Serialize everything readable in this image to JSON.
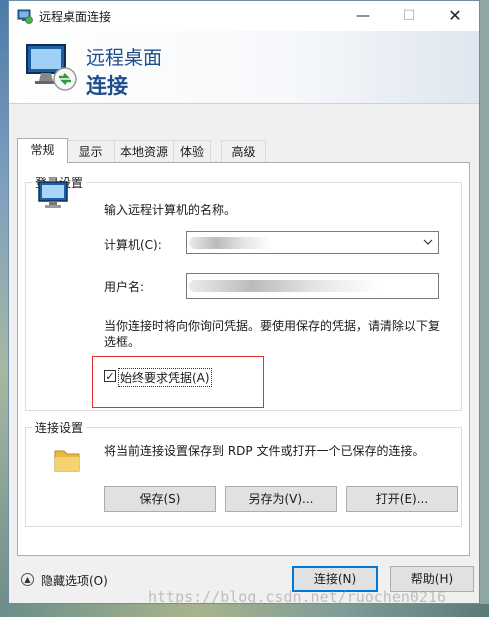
{
  "window": {
    "title": "远程桌面连接",
    "minimize_glyph": "—",
    "maximize_glyph": "☐",
    "close_glyph": "✕"
  },
  "banner": {
    "line1": "远程桌面",
    "line2": "连接"
  },
  "tabs": [
    {
      "label": "常规",
      "active": true
    },
    {
      "label": "显示",
      "active": false
    },
    {
      "label": "本地资源",
      "active": false
    },
    {
      "label": "体验",
      "active": false
    },
    {
      "label": "高级",
      "active": false
    }
  ],
  "login_settings": {
    "group_title": "登录设置",
    "instruction": "输入远程计算机的名称。",
    "computer_label": "计算机(C):",
    "computer_value": "",
    "username_label": "用户名:",
    "username_value": "",
    "note_line1": "当你连接时将向你询问凭据。要使用保存的凭据，请清除以下复",
    "note_line2": "选框。",
    "always_ask_label": "始终要求凭据(A)",
    "always_ask_checked": true,
    "checkmark_glyph": "✓"
  },
  "connection_settings": {
    "group_title": "连接设置",
    "description": "将当前连接设置保存到 RDP 文件或打开一个已保存的连接。",
    "save_label": "保存(S)",
    "save_as_label": "另存为(V)...",
    "open_label": "打开(E)..."
  },
  "footer": {
    "hide_options_label": "隐藏选项(O)",
    "hide_options_glyph": "▲",
    "connect_label": "连接(N)",
    "help_label": "帮助(H)"
  },
  "watermark": "https://blog.csdn.net/ruochen0216",
  "colors": {
    "accent": "#0078d7",
    "banner_text": "#1f4d8c",
    "highlight_box": "#e03030"
  },
  "icons": {
    "title": "remote-desktop-icon",
    "banner": "remote-desktop-icon",
    "computer": "computer-icon",
    "folder": "folder-icon",
    "dropdown": "chevron-down-icon"
  }
}
